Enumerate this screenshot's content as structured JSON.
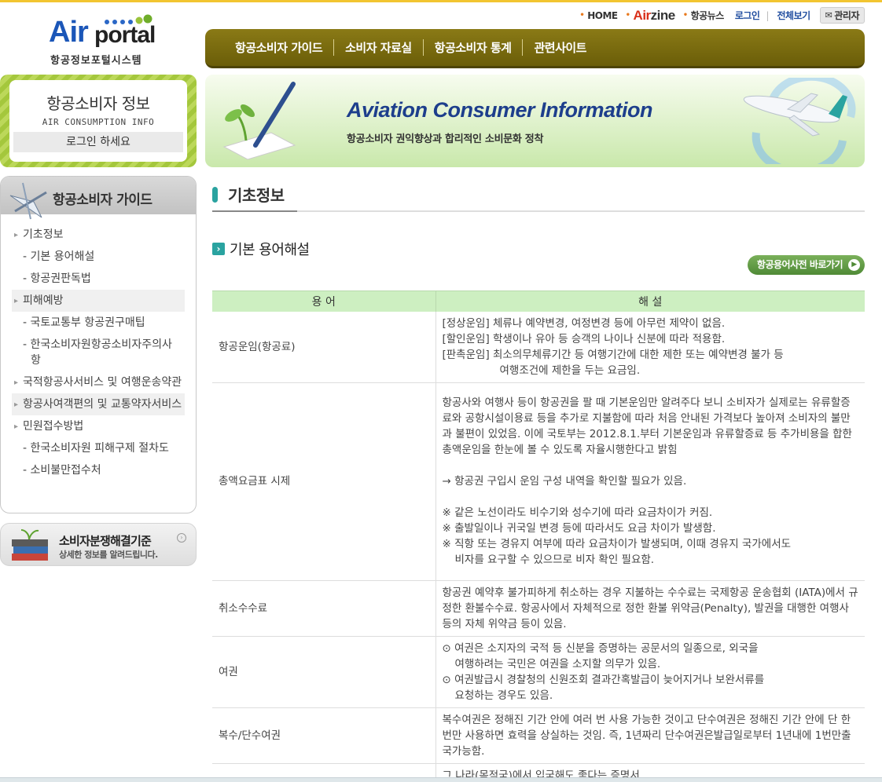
{
  "logo": {
    "air": "Air",
    "portal": "portal",
    "sub": "항공정보포털시스템"
  },
  "util": {
    "home": "HOME",
    "airzine_a": "Air",
    "airzine_b": "zine",
    "news": "항공뉴스",
    "login": "로그인",
    "sitemap": "전체보기",
    "admin": "관리자"
  },
  "gnb": [
    "항공소비자 가이드",
    "소비자 자료실",
    "항공소비자 통계",
    "관련사이트"
  ],
  "userbox": {
    "title": "항공소비자 정보",
    "subtitle": "AIR CONSUMPTION INFO",
    "login_prompt": "로그인 하세요"
  },
  "hero": {
    "en": "Aviation Consumer Information",
    "ko": "항공소비자 권익향상과 합리적인 소비문화 정착"
  },
  "lnb": {
    "title": "항공소비자 가이드",
    "items": [
      {
        "label": "기초정보",
        "level": 1
      },
      {
        "label": "기본 용어해설",
        "level": 2
      },
      {
        "label": "항공권판독법",
        "level": 2
      },
      {
        "label": "피해예방",
        "level": 1
      },
      {
        "label": "국토교통부 항공권구매팁",
        "level": 2
      },
      {
        "label": "한국소비자원항공소비자주의사항",
        "level": 2
      },
      {
        "label": "국적항공사서비스 및 여행운송약관",
        "level": 1
      },
      {
        "label": "항공사여객편의 및 교통약자서비스",
        "level": 1
      },
      {
        "label": "민원접수방법",
        "level": 1
      },
      {
        "label": "한국소비자원 피해구제 절차도",
        "level": 2
      },
      {
        "label": "소비불만접수처",
        "level": 2
      }
    ]
  },
  "dispute": {
    "title": "소비자분쟁해결기준",
    "sub": "상세한 정보를 알려드립니다."
  },
  "page": {
    "title": "기초정보",
    "section": "기본 용어해설",
    "dict_button": "항공용어사전 바로가기"
  },
  "table": {
    "headers": [
      "용 어",
      "해 설"
    ],
    "rows": [
      {
        "term": "항공운임(항공료)",
        "lines": [
          "[정상운임] 체류나 예약변경, 여정변경 등에 아무런 제약이 없음.",
          "[할인운임] 학생이나 유아 등 승객의 나이나 신분에 따라 적용함.",
          "[판촉운임] 최소의무체류기간 등 여행기간에 대한 제한 또는 예약변경 불가 등",
          "여행조건에 제한을 두는 요금임."
        ]
      },
      {
        "term": "총액요금표 시제",
        "para": "항공사와 여행사 등이 항공권을 팔 때 기본운임만 알려주다 보니 소비자가 실제로는 유류할증료와 공항시설이용료 등을 추가로 지불함에 따라 처음 안내된 가격보다 높아져 소비자의 불만과 불편이 있었음. 이에 국토부는 2012.8.1.부터 기본운임과 유류할증료 등 추가비용을 합한 총액운임을 한눈에 볼 수 있도록 자율시행한다고 밝힘",
        "arrow": "→ 항공권 구입시 운임 구성 내역을 확인할 필요가 있음.",
        "notes": [
          "※ 같은 노선이라도 비수기와 성수기에 따라 요금차이가 커짐.",
          "※ 출발일이나 귀국일 변경 등에 따라서도 요금 차이가 발생함.",
          "※ 직항 또는 경유지 여부에 따라 요금차이가 발생되며, 이때 경유지 국가에서도",
          "비자를 요구할 수 있으므로 비자 확인 필요함."
        ]
      },
      {
        "term": "취소수수료",
        "para": "항공권 예약후 불가피하게 취소하는 경우 지불하는 수수료는 국제항공 운송협회 (IATA)에서 규정한 환불수수료. 항공사에서 자체적으로 정한 환불 위약금(Penalty), 발권을 대행한 여행사 등의 자체 위약금 등이 있음."
      },
      {
        "term": "여권",
        "items": [
          "⊙ 여권은 소지자의 국적 등 신분을 증명하는 공문서의 일종으로, 외국을",
          "여행하려는 국민은 여권을 소지할 의무가 있음.",
          "⊙ 여권발급시 경찰청의 신원조회 결과간혹발급이 늦어지거나 보완서류를",
          "요청하는 경우도 있음."
        ]
      },
      {
        "term": "복수/단수여권",
        "para": "복수여권은 정해진 기간 안에 여러 번 사용 가능한 것이고 단수여권은 정해진 기간 안에 단 한번만 사용하면 효력을 상실하는 것임. 즉, 1년짜리 단수여권은발급일로부터 1년내에 1번만출국가능함."
      },
      {
        "term": "",
        "para": "그 나라(목적국)에서 입국해도 좋다는 증명서"
      }
    ]
  },
  "colors": {
    "gnb": "#7a6c0f",
    "accent": "#2aa3a0",
    "header_row": "#cdefc1",
    "brand_blue": "#1b56b8"
  }
}
